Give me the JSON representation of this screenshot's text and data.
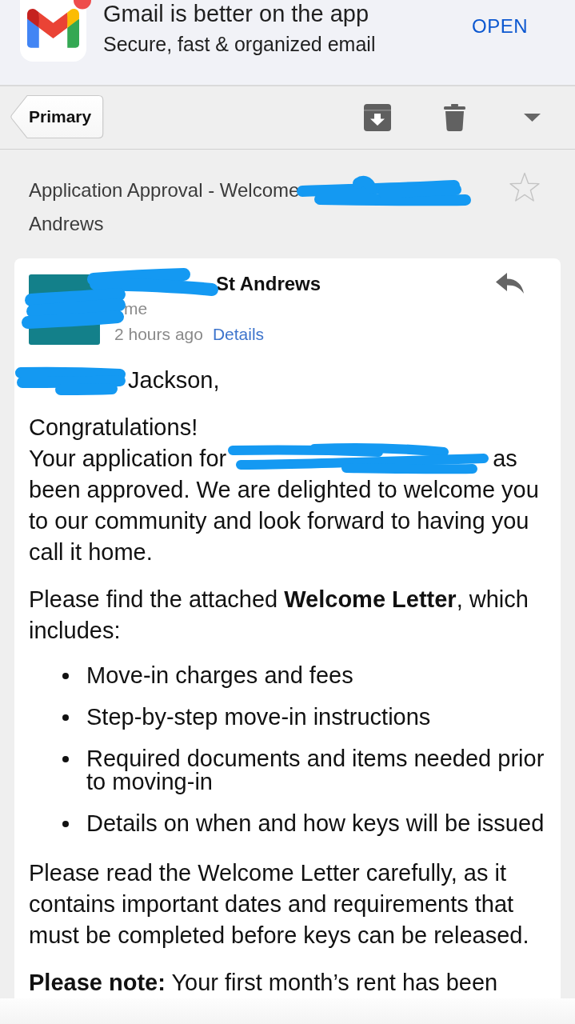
{
  "app_banner": {
    "title": "Gmail is better on the app",
    "subtitle": "Secure, fast & organized email",
    "open_button": "OPEN"
  },
  "toolbar": {
    "back_button": "Primary"
  },
  "subject": {
    "visible_start": "Application Approval - Welcome",
    "visible_end": "Andrews",
    "starred": false
  },
  "message": {
    "sender_visible": "St Andrews",
    "recipient_visible": "me",
    "time": "2 hours ago",
    "details_link": "Details",
    "greeting_visible": "Jackson,",
    "body": [
      {
        "kind": "paragraph",
        "parts": [
          {
            "kind": "text",
            "text": "Congratulations!"
          },
          {
            "kind": "redacted",
            "before": "Your application for",
            "after": "as"
          },
          {
            "kind": "text",
            "text": "been approved. We are delighted to welcome you to our community and look forward to having you call it home."
          }
        ]
      },
      {
        "kind": "paragraph",
        "parts": [
          {
            "kind": "text",
            "text": "Please find the attached **Welcome Letter**, which includes:"
          }
        ]
      },
      {
        "kind": "list",
        "items": [
          "Move-in charges and fees",
          "Step-by-step move-in instructions",
          "Required documents and items needed prior to moving-in",
          "Details on when and how keys will be issued"
        ]
      },
      {
        "kind": "paragraph",
        "parts": [
          {
            "kind": "text",
            "text": "Please read the Welcome Letter carefully, as it contains important dates and requirements that must be completed before keys can be released."
          }
        ]
      },
      {
        "kind": "paragraph",
        "parts": [
          {
            "kind": "text",
            "text": "**Please note:** Your first month’s rent has been"
          }
        ]
      }
    ]
  }
}
